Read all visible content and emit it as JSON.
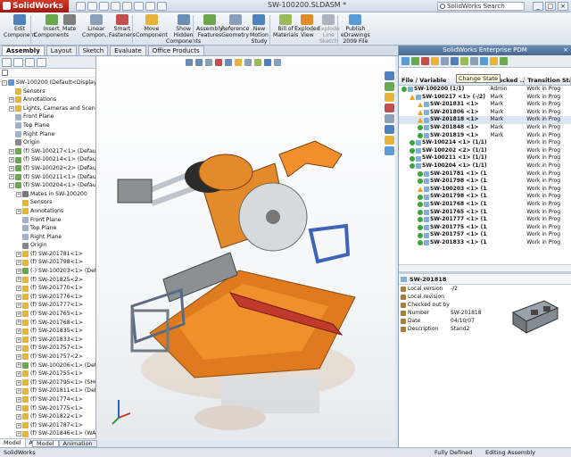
{
  "app": {
    "title": "SolidWorks",
    "document": "SW-100200.SLDASM *"
  },
  "search": {
    "placeholder": "SolidWorks Search"
  },
  "ribbon": {
    "buttons": [
      {
        "label1": "Edit",
        "label2": "Component"
      },
      {
        "label1": "Insert",
        "label2": "Components"
      },
      {
        "label1": "Mate",
        "label2": ""
      },
      {
        "label1": "Linear",
        "label2": "Compon..."
      },
      {
        "label1": "Smart",
        "label2": "Fasteners"
      },
      {
        "label1": "Move",
        "label2": "Component"
      },
      {
        "label1": "Show",
        "label2": "Hidden",
        "label3": "Components"
      },
      {
        "label1": "Assembly",
        "label2": "Features"
      },
      {
        "label1": "Reference",
        "label2": "Geometry"
      },
      {
        "label1": "New",
        "label2": "Motion",
        "label3": "Study"
      },
      {
        "label1": "Bill of",
        "label2": "Materials"
      },
      {
        "label1": "Exploded",
        "label2": "View"
      },
      {
        "label1": "Explode",
        "label2": "Line",
        "label3": "Sketch"
      },
      {
        "label1": "Publish",
        "label2": "eDrawings",
        "label3": "2009 File"
      }
    ]
  },
  "command_tabs": [
    "Assembly",
    "Layout",
    "Sketch",
    "Evaluate",
    "Office Products"
  ],
  "feature_tree": [
    {
      "text": "SW-100200  (Default<Display State-1>)",
      "indent": 0,
      "ex": "-",
      "color": "#5b9bd5"
    },
    {
      "text": "Sensors",
      "indent": 1,
      "ex": "",
      "color": "#e7b33a"
    },
    {
      "text": "Annotations",
      "indent": 1,
      "ex": "+",
      "color": "#e7b33a"
    },
    {
      "text": "Lights, Cameras and Scene",
      "indent": 1,
      "ex": "+",
      "color": "#e7b33a"
    },
    {
      "text": "Front Plane",
      "indent": 1,
      "ex": "",
      "color": "#9fb4cc"
    },
    {
      "text": "Top Plane",
      "indent": 1,
      "ex": "",
      "color": "#9fb4cc"
    },
    {
      "text": "Right Plane",
      "indent": 1,
      "ex": "",
      "color": "#9fb4cc"
    },
    {
      "text": "Origin",
      "indent": 1,
      "ex": "",
      "color": "#888"
    },
    {
      "text": "(f) SW-100217<1> (Default<Di",
      "indent": 1,
      "ex": "+",
      "color": "#6aa84f"
    },
    {
      "text": "(f) SW-100214<1> (Default<Di",
      "indent": 1,
      "ex": "+",
      "color": "#6aa84f"
    },
    {
      "text": "(f) SW-100202<2> (Default<Di",
      "indent": 1,
      "ex": "+",
      "color": "#6aa84f"
    },
    {
      "text": "(f) SW-100211<1> (Default<Di",
      "indent": 1,
      "ex": "+",
      "color": "#6aa84f"
    },
    {
      "text": "(f) SW-100204<1> (Default<D",
      "indent": 1,
      "ex": "-",
      "color": "#6aa84f"
    },
    {
      "text": "Mates in SW-100200",
      "indent": 2,
      "ex": "+",
      "color": "#7a7a7a"
    },
    {
      "text": "Sensors",
      "indent": 2,
      "ex": "",
      "color": "#e7b33a"
    },
    {
      "text": "Annotations",
      "indent": 2,
      "ex": "+",
      "color": "#e7b33a"
    },
    {
      "text": "Front Plane",
      "indent": 2,
      "ex": "",
      "color": "#9fb4cc"
    },
    {
      "text": "Top Plane",
      "indent": 2,
      "ex": "",
      "color": "#9fb4cc"
    },
    {
      "text": "Right Plane",
      "indent": 2,
      "ex": "",
      "color": "#9fb4cc"
    },
    {
      "text": "Origin",
      "indent": 2,
      "ex": "",
      "color": "#888"
    },
    {
      "text": "(f) SW-201781<1>",
      "indent": 2,
      "ex": "+",
      "color": "#e7b33a"
    },
    {
      "text": "(f) SW-201798<1>",
      "indent": 2,
      "ex": "+",
      "color": "#e7b33a"
    },
    {
      "text": "(-) SW-100203<1> (Default",
      "indent": 2,
      "ex": "+",
      "color": "#6aa84f"
    },
    {
      "text": "(f) SW-201825<2>",
      "indent": 2,
      "ex": "+",
      "color": "#e7b33a"
    },
    {
      "text": "(f) SW-201770<1>",
      "indent": 2,
      "ex": "+",
      "color": "#e7b33a"
    },
    {
      "text": "(f) SW-201776<1>",
      "indent": 2,
      "ex": "+",
      "color": "#e7b33a"
    },
    {
      "text": "(f) SW-201777<1>",
      "indent": 2,
      "ex": "+",
      "color": "#e7b33a"
    },
    {
      "text": "(f) SW-201765<1>",
      "indent": 2,
      "ex": "+",
      "color": "#e7b33a"
    },
    {
      "text": "(f) SW-201768<1>",
      "indent": 2,
      "ex": "+",
      "color": "#e7b33a"
    },
    {
      "text": "(f) SW-201835<1>",
      "indent": 2,
      "ex": "+",
      "color": "#e7b33a"
    },
    {
      "text": "(f) SW-201833<1>",
      "indent": 2,
      "ex": "+",
      "color": "#e7b33a"
    },
    {
      "text": "(f) SW-201757<1>",
      "indent": 2,
      "ex": "+",
      "color": "#e7b33a"
    },
    {
      "text": "(f) SW-201757<2>",
      "indent": 2,
      "ex": "+",
      "color": "#e7b33a"
    },
    {
      "text": "(f) SW-100206<1> (Default",
      "indent": 2,
      "ex": "+",
      "color": "#6aa84f"
    },
    {
      "text": "(f) SW-201755<1>",
      "indent": 2,
      "ex": "+",
      "color": "#e7b33a"
    },
    {
      "text": "(f) SW-201795<1> (SHOULI",
      "indent": 2,
      "ex": "+",
      "color": "#e7b33a"
    },
    {
      "text": "(f) SW-201811<1> (Default",
      "indent": 2,
      "ex": "+",
      "color": "#e7b33a"
    },
    {
      "text": "(f) SW-201774<1>",
      "indent": 2,
      "ex": "+",
      "color": "#e7b33a"
    },
    {
      "text": "(f) SW-201775<1>",
      "indent": 2,
      "ex": "+",
      "color": "#e7b33a"
    },
    {
      "text": "(f) SW-201822<1>",
      "indent": 2,
      "ex": "+",
      "color": "#e7b33a"
    },
    {
      "text": "(f) SW-201787<1>",
      "indent": 2,
      "ex": "+",
      "color": "#e7b33a"
    },
    {
      "text": "(f) SW-201846<1> (WASHE",
      "indent": 2,
      "ex": "+",
      "color": "#e7b33a"
    },
    {
      "text": "(f) SW-201802<2>",
      "indent": 2,
      "ex": "+",
      "color": "#e7b33a"
    },
    {
      "text": "Mates",
      "indent": 2,
      "ex": "+",
      "color": "#7a7a7a"
    }
  ],
  "bottom_tabs": [
    "Model",
    "Animation"
  ],
  "pdm": {
    "title": "SolidWorks Enterprise PDM",
    "tooltip": "Change State",
    "columns": [
      "File / Variable",
      "Checked ...",
      "Transition State"
    ],
    "rows": [
      {
        "name": "SW-100200 (1/1)",
        "indent": 0,
        "warn": false,
        "checked": "Admin",
        "state": "Work in Prog",
        "sel": false
      },
      {
        "name": "SW-100217 <1> (-/2)",
        "indent": 1,
        "warn": true,
        "checked": "Mark",
        "state": "Work in Prog",
        "sel": false
      },
      {
        "name": "SW-201831 <1>",
        "indent": 2,
        "warn": true,
        "checked": "Mark",
        "state": "Work in Prog",
        "sel": false
      },
      {
        "name": "SW-201806 <1>",
        "indent": 2,
        "warn": true,
        "checked": "Mark",
        "state": "Work in Prog",
        "sel": false
      },
      {
        "name": "SW-201818 <1>",
        "indent": 2,
        "warn": true,
        "checked": "Mark",
        "state": "Work in Prog",
        "sel": true
      },
      {
        "name": "SW-201848 <1>",
        "indent": 2,
        "warn": false,
        "checked": "Mark",
        "state": "Work in Prog",
        "sel": false
      },
      {
        "name": "SW-201819 <1>",
        "indent": 2,
        "warn": false,
        "checked": "Mark",
        "state": "Work in Prog",
        "sel": false
      },
      {
        "name": "SW-100214 <1> (1/1)",
        "indent": 1,
        "warn": false,
        "checked": "",
        "state": "Work in Prog",
        "sel": false
      },
      {
        "name": "SW-100202 <2> (1/1)",
        "indent": 1,
        "warn": false,
        "checked": "",
        "state": "Work in Prog",
        "sel": false
      },
      {
        "name": "SW-100211 <1> (1/1)",
        "indent": 1,
        "warn": false,
        "checked": "",
        "state": "Work in Prog",
        "sel": false
      },
      {
        "name": "SW-100204 <1> (1/1)",
        "indent": 1,
        "warn": false,
        "checked": "",
        "state": "Work in Prog",
        "sel": false
      },
      {
        "name": "SW-201781 <1> (1/1)",
        "indent": 2,
        "warn": false,
        "checked": "",
        "state": "Work in Prog",
        "sel": false
      },
      {
        "name": "SW-201798 <1> (1/1)",
        "indent": 2,
        "warn": false,
        "checked": "",
        "state": "Work in Prog",
        "sel": false
      },
      {
        "name": "SW-100203 <1> (1/1)",
        "indent": 2,
        "warn": true,
        "checked": "",
        "state": "Work in Prog",
        "sel": false
      },
      {
        "name": "SW-201798 <1> (1/1)",
        "indent": 2,
        "warn": false,
        "checked": "",
        "state": "Work in Prog",
        "sel": false
      },
      {
        "name": "SW-201768 <1> (1/1)",
        "indent": 2,
        "warn": false,
        "checked": "",
        "state": "Work in Prog",
        "sel": false
      },
      {
        "name": "SW-201765 <1> (1/1)",
        "indent": 2,
        "warn": false,
        "checked": "",
        "state": "Work in Prog",
        "sel": false
      },
      {
        "name": "SW-201777 <1> (1/1)",
        "indent": 2,
        "warn": false,
        "checked": "",
        "state": "Work in Prog",
        "sel": false
      },
      {
        "name": "SW-201775 <1> (1/1)",
        "indent": 2,
        "warn": false,
        "checked": "",
        "state": "Work in Prog",
        "sel": false
      },
      {
        "name": "SW-201757 <1> (1/1)",
        "indent": 2,
        "warn": false,
        "checked": "",
        "state": "Work in Prog",
        "sel": false
      },
      {
        "name": "SW-201833 <1> (1/1)",
        "indent": 2,
        "warn": false,
        "checked": "",
        "state": "Work in Prog",
        "sel": false
      }
    ],
    "detail": {
      "title": "SW-201818",
      "fields": [
        {
          "key": "Local version",
          "value": "-/2"
        },
        {
          "key": "Local revision",
          "value": ""
        },
        {
          "key": "Checked out by",
          "value": ""
        },
        {
          "key": "Number",
          "value": "SW-201818"
        },
        {
          "key": "Date",
          "value": "04/10/07"
        },
        {
          "key": "Description",
          "value": "Stand2"
        }
      ]
    }
  },
  "status": {
    "left": "SolidWorks",
    "fully": "Fully Defined",
    "editing": "Editing Assembly"
  }
}
